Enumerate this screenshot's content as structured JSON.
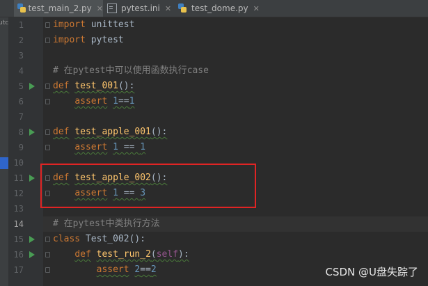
{
  "tabs": [
    {
      "label": "test_main_2.py",
      "icon": "python-file-icon",
      "active": true
    },
    {
      "label": "pytest.ini",
      "icon": "ini-file-icon",
      "active": false
    },
    {
      "label": "test_dome.py",
      "icon": "python-file-icon",
      "active": false
    }
  ],
  "sidebar_fragment": "utc",
  "editor": {
    "line_numbers": [
      "1",
      "2",
      "3",
      "4",
      "5",
      "6",
      "7",
      "8",
      "9",
      "10",
      "11",
      "12",
      "13",
      "14",
      "15",
      "16",
      "17"
    ],
    "current_line": "14",
    "lines": [
      {
        "num": "1",
        "segments": [
          {
            "t": "import",
            "c": "kw"
          },
          {
            "t": " unittest",
            "c": ""
          }
        ]
      },
      {
        "num": "2",
        "segments": [
          {
            "t": "import",
            "c": "kw"
          },
          {
            "t": " pytest",
            "c": ""
          }
        ]
      },
      {
        "num": "3",
        "segments": []
      },
      {
        "num": "4",
        "segments": [
          {
            "t": "# 在pytest中可以使用函数执行case",
            "c": "cm"
          }
        ]
      },
      {
        "num": "5",
        "segments": [
          {
            "t": "def",
            "c": "kw"
          },
          {
            "t": " ",
            "c": ""
          },
          {
            "t": "test_001",
            "c": "fn"
          },
          {
            "t": "():",
            "c": ""
          }
        ]
      },
      {
        "num": "6",
        "segments": [
          {
            "t": "    ",
            "c": ""
          },
          {
            "t": "assert",
            "c": "kw"
          },
          {
            "t": " ",
            "c": ""
          },
          {
            "t": "1",
            "c": "num"
          },
          {
            "t": "==",
            "c": ""
          },
          {
            "t": "1",
            "c": "num"
          }
        ]
      },
      {
        "num": "7",
        "segments": []
      },
      {
        "num": "8",
        "segments": [
          {
            "t": "def",
            "c": "kw"
          },
          {
            "t": " ",
            "c": ""
          },
          {
            "t": "test_apple_001",
            "c": "fn"
          },
          {
            "t": "():",
            "c": ""
          }
        ]
      },
      {
        "num": "9",
        "segments": [
          {
            "t": "    ",
            "c": ""
          },
          {
            "t": "assert",
            "c": "kw"
          },
          {
            "t": " ",
            "c": ""
          },
          {
            "t": "1",
            "c": "num"
          },
          {
            "t": " == ",
            "c": ""
          },
          {
            "t": "1",
            "c": "num"
          }
        ]
      },
      {
        "num": "10",
        "segments": []
      },
      {
        "num": "11",
        "segments": [
          {
            "t": "def",
            "c": "kw"
          },
          {
            "t": " ",
            "c": ""
          },
          {
            "t": "test_apple_002",
            "c": "fn"
          },
          {
            "t": "():",
            "c": ""
          }
        ]
      },
      {
        "num": "12",
        "segments": [
          {
            "t": "    ",
            "c": ""
          },
          {
            "t": "assert",
            "c": "kw"
          },
          {
            "t": " ",
            "c": ""
          },
          {
            "t": "1",
            "c": "num"
          },
          {
            "t": " == ",
            "c": ""
          },
          {
            "t": "3",
            "c": "num"
          }
        ]
      },
      {
        "num": "13",
        "segments": []
      },
      {
        "num": "14",
        "segments": [
          {
            "t": "# 在pytest中类执行方法",
            "c": "cm"
          }
        ]
      },
      {
        "num": "15",
        "segments": [
          {
            "t": "class",
            "c": "kw"
          },
          {
            "t": " Test_002():",
            "c": ""
          }
        ]
      },
      {
        "num": "16",
        "segments": [
          {
            "t": "    ",
            "c": ""
          },
          {
            "t": "def",
            "c": "kw"
          },
          {
            "t": " ",
            "c": ""
          },
          {
            "t": "test_run_2",
            "c": "fn"
          },
          {
            "t": "(",
            "c": ""
          },
          {
            "t": "self",
            "c": "slf"
          },
          {
            "t": "):",
            "c": ""
          }
        ]
      },
      {
        "num": "17",
        "segments": [
          {
            "t": "        ",
            "c": ""
          },
          {
            "t": "assert",
            "c": "kw"
          },
          {
            "t": " ",
            "c": ""
          },
          {
            "t": "2",
            "c": "num"
          },
          {
            "t": "==",
            "c": ""
          },
          {
            "t": "2",
            "c": "num"
          }
        ]
      }
    ],
    "run_markers": [
      "5",
      "8",
      "11",
      "15",
      "16"
    ]
  },
  "colors": {
    "keyword": "#cc7832",
    "function": "#ffc66d",
    "number": "#6897bb",
    "comment": "#808080",
    "highlight_box": "#e02424",
    "run_marker": "#499c54"
  },
  "watermark": "CSDN @U盘失踪了"
}
